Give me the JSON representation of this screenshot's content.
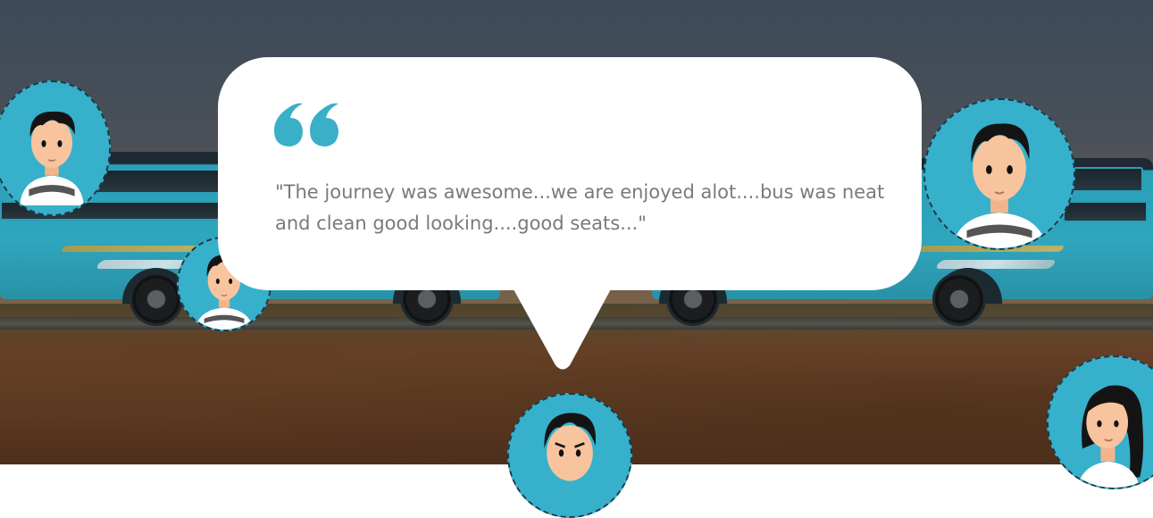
{
  "testimonial": {
    "quote_icon": "quote-open-icon",
    "text": "\"The journey was awesome...we are enjoyed alot....bus was neat and clean good looking....good seats...\""
  },
  "avatars": [
    {
      "icon": "male-avatar-icon"
    },
    {
      "icon": "male-avatar-icon"
    },
    {
      "icon": "male-avatar-icon"
    },
    {
      "icon": "male-avatar-icon"
    },
    {
      "icon": "female-avatar-icon"
    }
  ],
  "colors": {
    "accent": "#3aafc8",
    "bubble": "#ffffff",
    "quote_text": "#7a7a7a",
    "avatar_bg": "#37b0cc"
  }
}
